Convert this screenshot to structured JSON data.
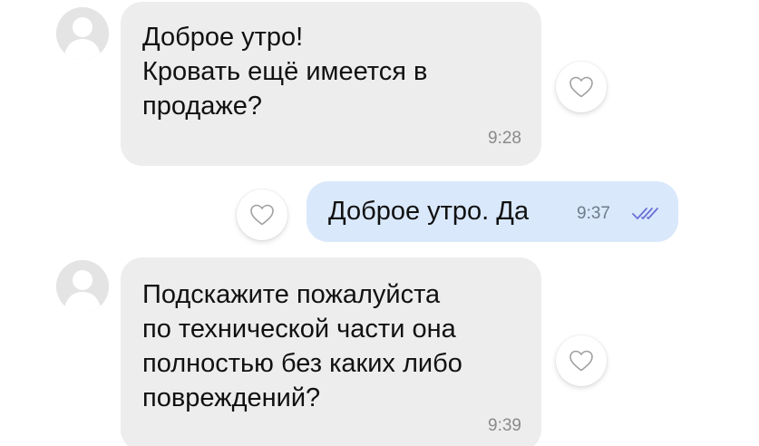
{
  "messages": [
    {
      "direction": "incoming",
      "lines": [
        "Доброе утро!",
        "Кровать ещё имеется в",
        "продаже?"
      ],
      "time": "9:28"
    },
    {
      "direction": "outgoing",
      "lines": [
        "Доброе утро. Да"
      ],
      "time": "9:37",
      "status": "read"
    },
    {
      "direction": "incoming",
      "lines": [
        "Подскажите пожалуйста",
        "по технической части она",
        "полностью без каких либо",
        "повреждений?"
      ],
      "time": "9:39"
    }
  ],
  "icons": {
    "avatar": "user-silhouette-icon",
    "like": "heart-outline-icon",
    "read_status": "double-check-icon"
  },
  "colors": {
    "incoming_bubble": "#ededed",
    "outgoing_bubble": "#d9e8fb",
    "read_check": "#6a6fd8",
    "heart_outline": "#a0a0a0"
  }
}
